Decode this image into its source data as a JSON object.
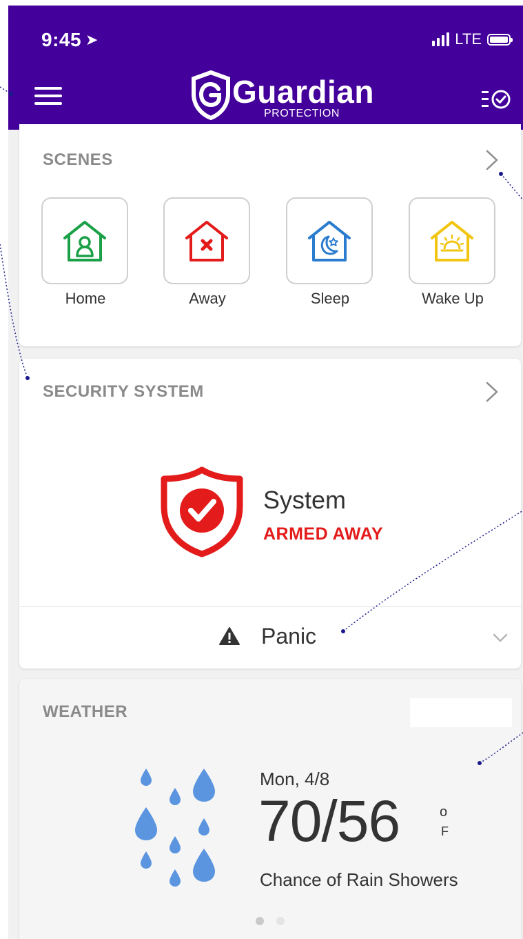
{
  "status_bar": {
    "time": "9:45",
    "network": "LTE"
  },
  "header": {
    "logo_text": "Guardian",
    "logo_subtext": "PROTECTION"
  },
  "scenes": {
    "title": "SCENES",
    "items": [
      {
        "label": "Home",
        "icon": "home-scene-icon",
        "color": "#1aa046"
      },
      {
        "label": "Away",
        "icon": "away-scene-icon",
        "color": "#e31b1b"
      },
      {
        "label": "Sleep",
        "icon": "sleep-scene-icon",
        "color": "#2a7ccf"
      },
      {
        "label": "Wake Up",
        "icon": "wake-up-scene-icon",
        "color": "#f2c511"
      }
    ]
  },
  "security": {
    "title": "SECURITY SYSTEM",
    "system_label": "System",
    "status": "ARMED AWAY",
    "status_color": "#e31b1b",
    "panic_label": "Panic"
  },
  "weather": {
    "title": "WEATHER",
    "date": "Mon, 4/8",
    "temps": "70/56",
    "unit_top": "o",
    "unit_bottom": "F",
    "condition": "Chance of Rain Showers",
    "icon": "rain-icon",
    "page_index": 1,
    "page_count": 2
  },
  "colors": {
    "brand": "#43009b",
    "accent_red": "#e31b1b",
    "rain": "#5b95e0"
  }
}
